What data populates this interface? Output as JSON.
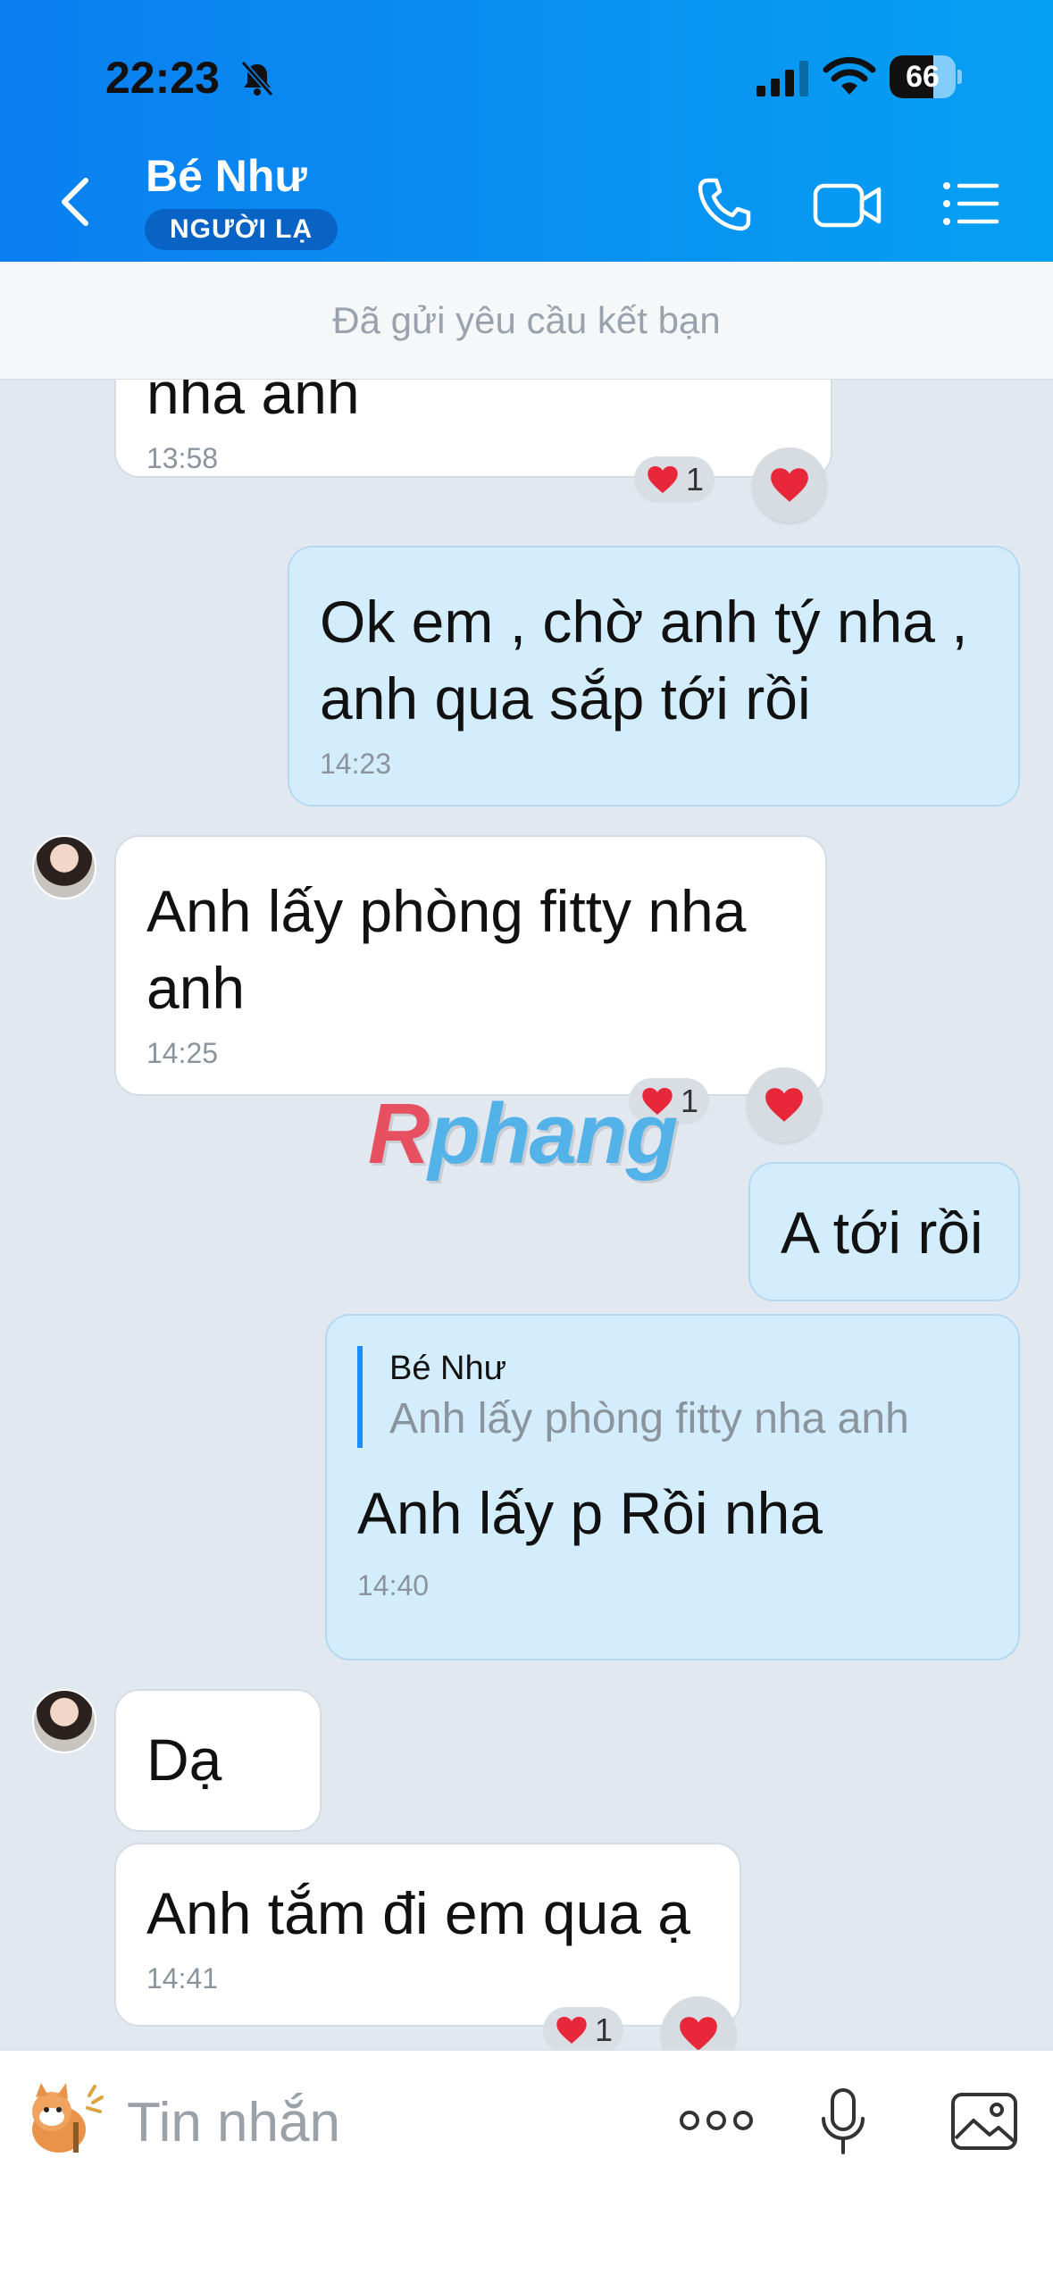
{
  "status_bar": {
    "time": "22:23",
    "battery": "66",
    "battery_level": 0.66
  },
  "header": {
    "name": "Bé Như",
    "badge": "NGƯỜI LẠ"
  },
  "banner": "Đã gửi yêu cầu kết bạn",
  "messages": [
    {
      "side": "in",
      "text": "nha anh",
      "time": "13:58",
      "reaction_count": "1"
    },
    {
      "side": "out",
      "text": "Ok em , chờ anh tý nha , anh qua sắp tới rồi",
      "time": "14:23"
    },
    {
      "side": "in",
      "text": "Anh lấy phòng fitty nha anh",
      "time": "14:25",
      "reaction_count": "1"
    },
    {
      "side": "out",
      "text": "A tới rồi"
    },
    {
      "side": "out",
      "quote_author": "Bé Như",
      "quote_text": "Anh lấy phòng fitty nha anh",
      "text": "Anh lấy p Rồi nha",
      "time": "14:40"
    },
    {
      "side": "in",
      "text": "Dạ"
    },
    {
      "side": "in",
      "text": "Anh tắm đi em qua ạ",
      "time": "14:41",
      "reaction_count": "1"
    }
  ],
  "watermark": {
    "r": "R",
    "rest": "phang"
  },
  "input": {
    "placeholder": "Tin nhắn"
  },
  "colors": {
    "header": "#0a86f1",
    "outgoing": "#d4edfc",
    "incoming": "#ffffff",
    "heart": "#e8273a"
  }
}
